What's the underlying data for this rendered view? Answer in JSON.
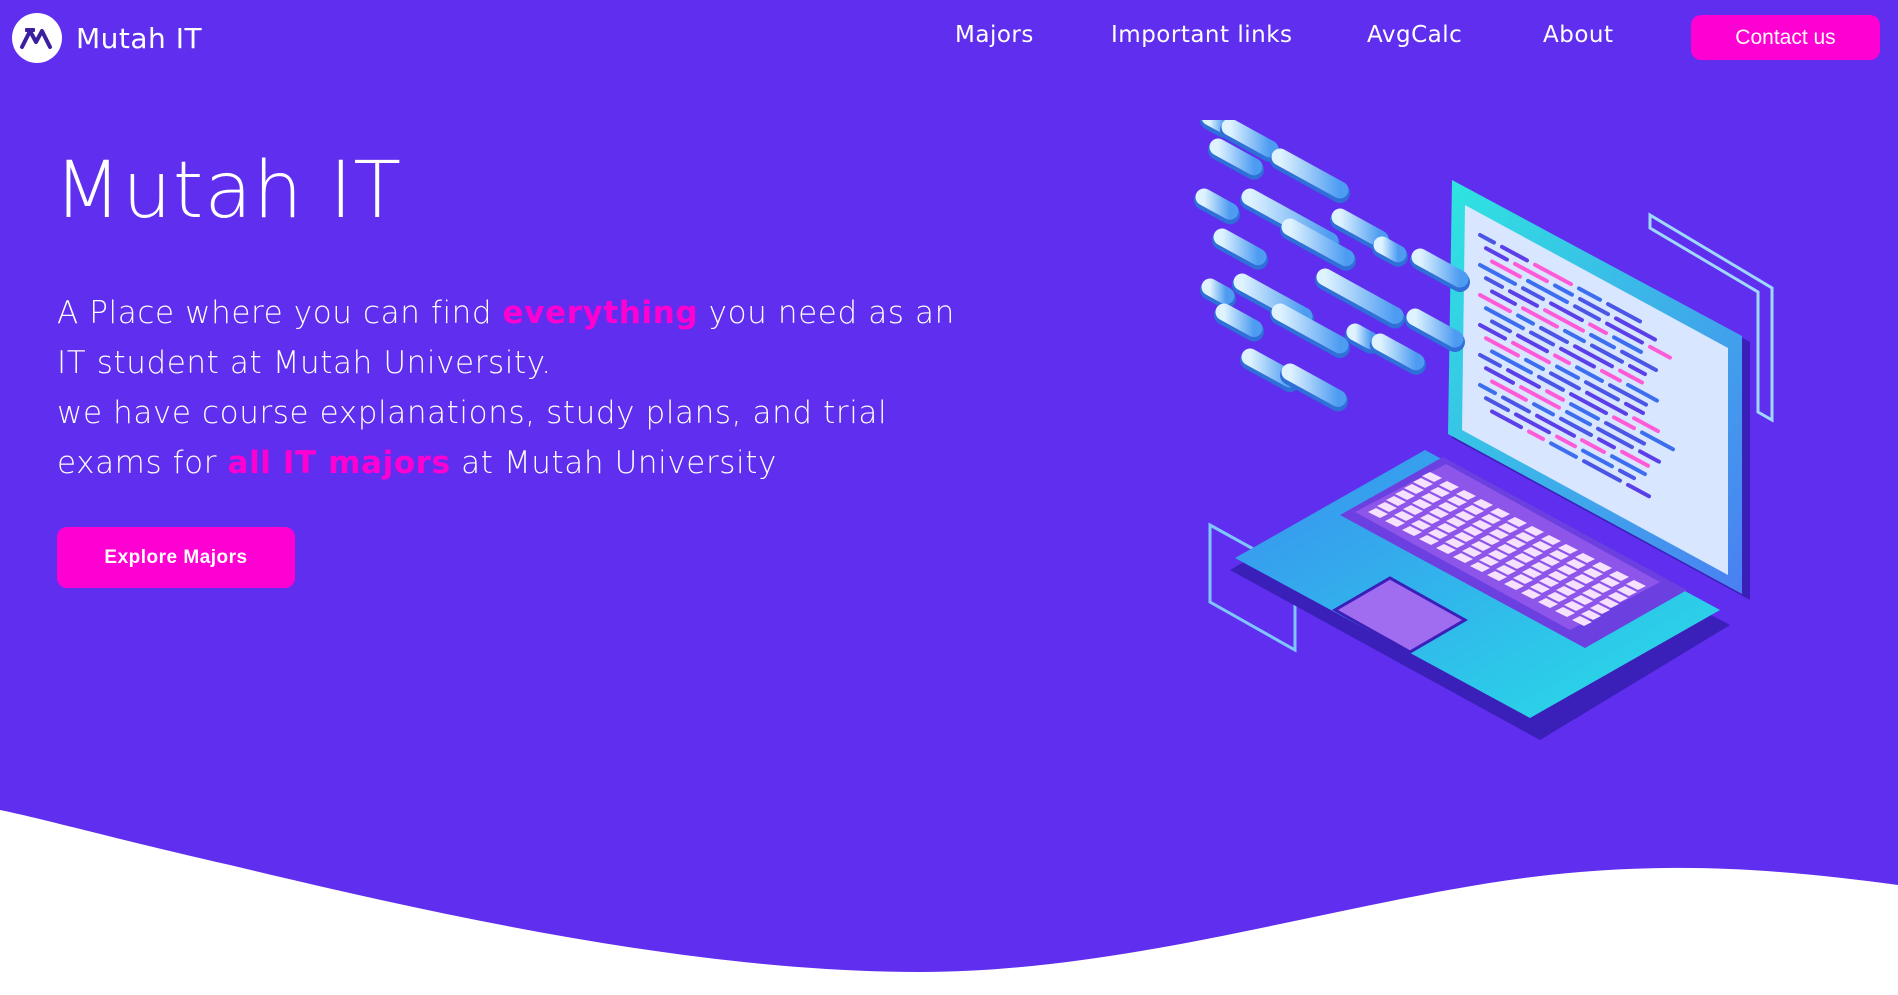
{
  "colors": {
    "hero_bg": "#5f2eee",
    "accent": "#ff00d2",
    "text": "#ffffff"
  },
  "navbar": {
    "logo_icon": "mutah-it-logo-icon",
    "brand": "Mutah IT",
    "links": [
      "Majors",
      "Important links",
      "AvgCalc",
      "About"
    ],
    "contact_label": "Contact us"
  },
  "hero": {
    "title": "Mutah IT",
    "desc_part1": "A Place where you can find ",
    "desc_highlight1": "everything",
    "desc_part2": " you need as an IT student at Mutah University.",
    "desc_part3": "we have course explanations, study plans, and trial exams for ",
    "desc_highlight2": "all IT majors",
    "desc_part4": " at Mutah University",
    "cta_label": "Explore Majors",
    "illustration_icon": "isometric-laptop-code-illustration"
  }
}
